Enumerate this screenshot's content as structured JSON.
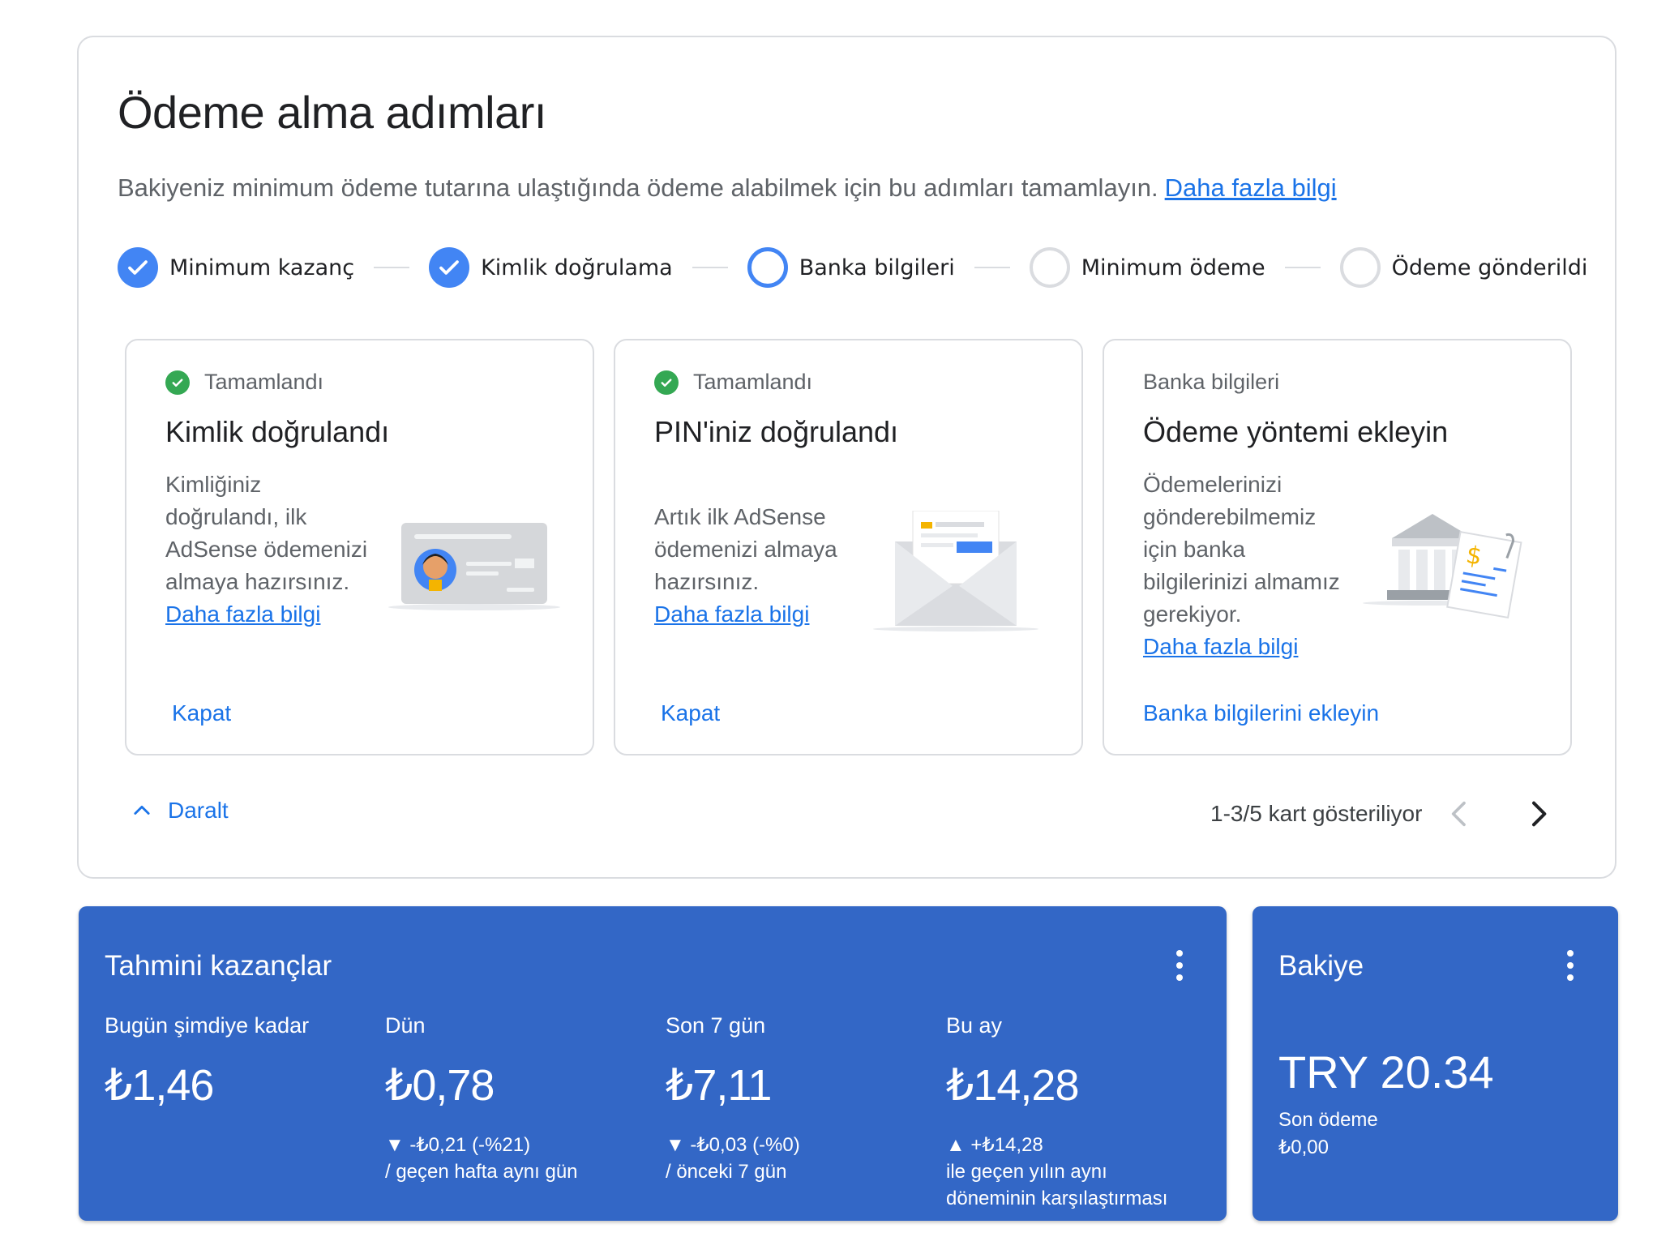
{
  "steps_panel": {
    "title": "Ödeme alma adımları",
    "description": "Bakiyeniz minimum ödeme tutarına ulaştığında ödeme alabilmek için bu adımları tamamlayın.",
    "learn_more": "Daha fazla bilgi",
    "steps": [
      {
        "label": "Minimum kazanç",
        "state": "done"
      },
      {
        "label": "Kimlik doğrulama",
        "state": "done"
      },
      {
        "label": "Banka bilgileri",
        "state": "current"
      },
      {
        "label": "Minimum ödeme",
        "state": "todo"
      },
      {
        "label": "Ödeme gönderildi",
        "state": "todo"
      }
    ],
    "cards": [
      {
        "status": "Tamamlandı",
        "title": "Kimlik doğrulandı",
        "body": "Kimliğiniz doğrulandı, ilk AdSense ödemenizi almaya hazırsınız.",
        "link": "Daha fazla bilgi",
        "action": "Kapat",
        "illustration": "id-card-icon"
      },
      {
        "status": "Tamamlandı",
        "title": "PIN'iniz doğrulandı",
        "body": "Artık ilk AdSense ödemenizi almaya hazırsınız.",
        "link": "Daha fazla bilgi",
        "action": "Kapat",
        "illustration": "envelope-icon"
      },
      {
        "status": "Banka bilgileri",
        "title": "Ödeme yöntemi ekleyin",
        "body": "Ödemelerinizi gönderebilmemiz için banka bilgilerinizi almamız gerekiyor.",
        "link": "Daha fazla bilgi",
        "action": "Banka bilgilerini ekleyin",
        "illustration": "bank-icon"
      }
    ],
    "collapse_label": "Daralt",
    "pager_text": "1-3/5 kart gösteriliyor"
  },
  "earnings": {
    "title": "Tahmini kazançlar",
    "metrics": [
      {
        "label": "Bugün şimdiye kadar",
        "value": "₺1,46",
        "change": "",
        "compare": ""
      },
      {
        "label": "Dün",
        "value": "₺0,78",
        "change": "▼ -₺0,21 (-%21)",
        "compare": "/ geçen hafta aynı gün"
      },
      {
        "label": "Son 7 gün",
        "value": "₺7,11",
        "change": "▼ -₺0,03 (-%0)",
        "compare": "/ önceki 7 gün"
      },
      {
        "label": "Bu ay",
        "value": "₺14,28",
        "change": "▲ +₺14,28",
        "compare": "ile geçen yılın aynı",
        "compare2": "döneminin karşılaştırması"
      }
    ]
  },
  "balance": {
    "title": "Bakiye",
    "value": "TRY 20.34",
    "last_payment_label": "Son ödeme",
    "last_payment_value": "₺0,00"
  },
  "colors": {
    "accent": "#1a73e8",
    "card_blue": "#3367c6",
    "check_green": "#34a853",
    "step_blue": "#4285f4"
  }
}
